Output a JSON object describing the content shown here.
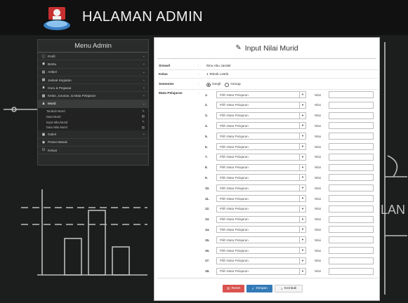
{
  "header": {
    "title": "HALAMAN ADMIN"
  },
  "sidebar": {
    "title": "Menu Admin",
    "items": [
      {
        "label": "Profil",
        "icon": "info-icon",
        "has_caret": true
      },
      {
        "label": "Berita",
        "icon": "globe-icon",
        "has_caret": true
      },
      {
        "label": "Artikel",
        "icon": "newspaper-icon",
        "has_caret": true
      },
      {
        "label": "Jadwal Kegiatan",
        "icon": "calendar-icon",
        "has_caret": true
      },
      {
        "label": "Guru & Pegawai",
        "icon": "user-icon",
        "has_caret": true
      },
      {
        "label": "Kelas, Jurusan, & Mata Pelajaran",
        "icon": "building-icon",
        "has_caret": true
      },
      {
        "label": "Murid",
        "icon": "user-icon",
        "has_caret": true
      }
    ],
    "submenu": [
      {
        "label": "Tambah Murid",
        "icon": "pencil-icon"
      },
      {
        "label": "Data Murid",
        "icon": "list-icon"
      },
      {
        "label": "Input Nilai Murid",
        "icon": "pencil-icon"
      },
      {
        "label": "Data Nilai Murid",
        "icon": "list-icon"
      }
    ],
    "items_after": [
      {
        "label": "Galeri",
        "icon": "image-icon",
        "has_caret": true
      },
      {
        "label": "Pesan Masuk",
        "icon": "eye-icon",
        "has_caret": false
      },
      {
        "label": "Keluar",
        "icon": "power-icon",
        "has_caret": false
      }
    ]
  },
  "form": {
    "title": "Input Nilai Murid",
    "fields": {
      "siswa_label": "Siswa/i",
      "siswa_value": "Ibnu Abu Jandal",
      "kelas_label": "Kelas",
      "kelas_value": "1 Teknik Listrik",
      "semester_label": "Semester",
      "semester_options": [
        "Genjil",
        "Genap"
      ],
      "semester_selected": "Genjil",
      "mapel_label": "Mata Pelajaran"
    },
    "select_placeholder": "Pilih Mata Pelajaran",
    "nilai_label": "Nilai",
    "rows": [
      "1.",
      "2.",
      "3.",
      "4.",
      "5.",
      "6.",
      "7.",
      "8.",
      "9.",
      "10.",
      "11.",
      "12.",
      "13.",
      "14.",
      "15.",
      "16.",
      "17.",
      "18."
    ],
    "buttons": {
      "reset": "Reset",
      "simpan": "Simpan",
      "kembali": "Kembali"
    }
  },
  "colors": {
    "background": "#1d1f1e",
    "reset": "#d9534f",
    "simpan": "#337ab7"
  }
}
